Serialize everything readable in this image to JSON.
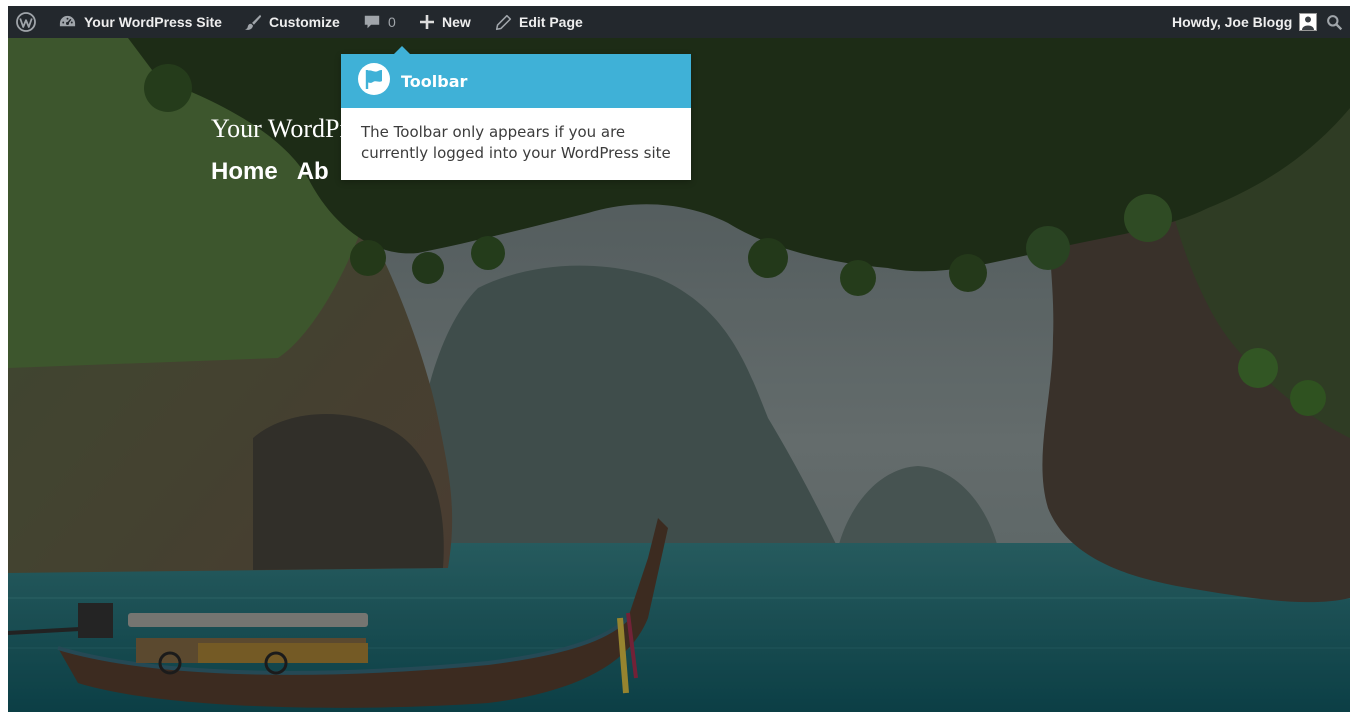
{
  "adminbar": {
    "wp_logo_icon": "wordpress-logo-icon",
    "site_name": "Your WordPress Site",
    "customize_label": "Customize",
    "comments_count": "0",
    "new_label": "New",
    "edit_page_label": "Edit Page",
    "howdy_text": "Howdy, Joe Blogg",
    "background_color": "#23282d"
  },
  "site": {
    "title": "Your WordPress site",
    "nav": [
      "Home",
      "Ab"
    ]
  },
  "tooltip": {
    "title": "Toolbar",
    "body": "The Toolbar only appears if you are currently logged into your WordPress site",
    "header_color": "#3fb1d7",
    "icon": "flag-icon"
  }
}
